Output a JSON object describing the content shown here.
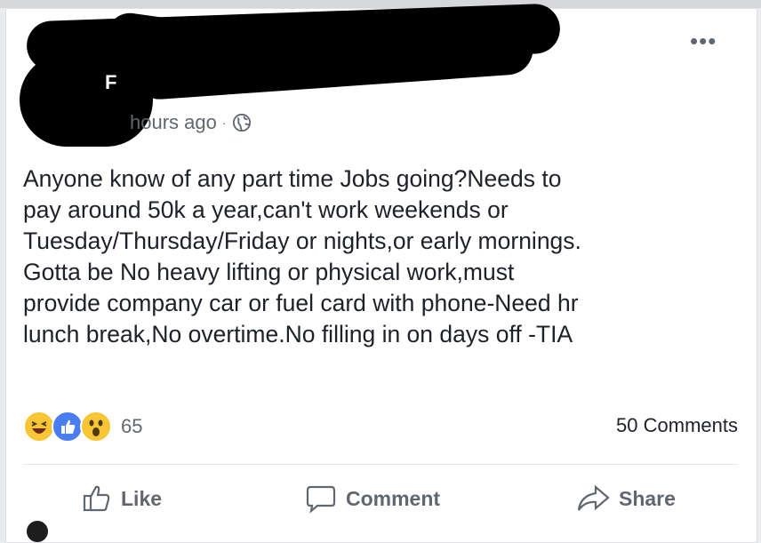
{
  "post": {
    "timestamp": "hours ago",
    "separator": "·",
    "author_initial": "F",
    "text": "Anyone know of any part time Jobs going?Needs to\npay around 50k a year,can't work weekends or\nTuesday/Thursday/Friday or nights,or early mornings.\nGotta be No heavy lifting or physical work,must\nprovide company car or fuel card with phone-Need hr\nlunch break,No overtime.No filling in on days off -TIA",
    "more_icon": "more-options-icon",
    "privacy_icon": "globe-icon"
  },
  "reactions": {
    "types": [
      "haha",
      "like",
      "wow"
    ],
    "count": "65"
  },
  "comments_count": "50 Comments",
  "actions": {
    "like": "Like",
    "comment": "Comment",
    "share": "Share"
  },
  "colors": {
    "text": "#1d2129",
    "muted": "#606770",
    "like_blue": "#4a7ef0",
    "emoji_yellow": "#f7c536"
  }
}
